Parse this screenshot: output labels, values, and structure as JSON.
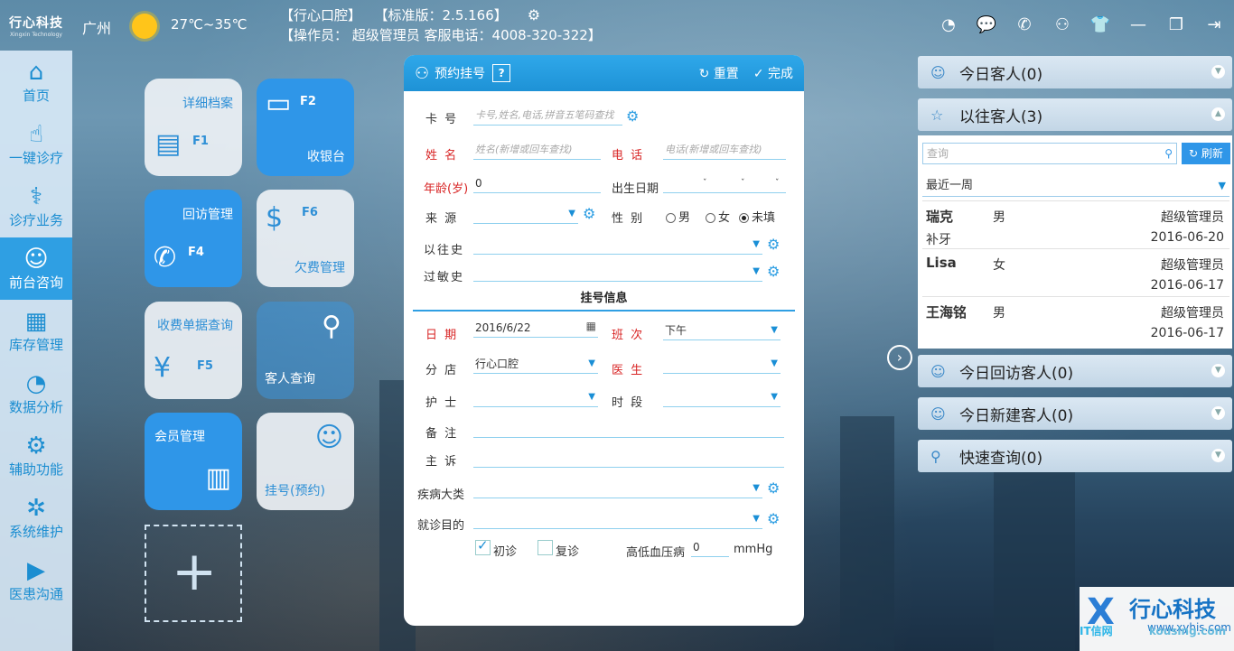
{
  "app": {
    "logo_text": "行心科技",
    "logo_sub": "Xingxin Technology"
  },
  "weather": {
    "city": "广州",
    "temp": "27℃~35℃"
  },
  "header": {
    "clinic": "【行心口腔】",
    "edition": "【标准版：2.5.166】",
    "operator": "【操作员： 超级管理员  客服电话：4008-320-322】"
  },
  "sidebar": {
    "items": [
      {
        "label": "首页",
        "icon": "home-icon"
      },
      {
        "label": "一键诊疗",
        "icon": "hand-icon"
      },
      {
        "label": "诊疗业务",
        "icon": "doctor-icon"
      },
      {
        "label": "前台咨询",
        "icon": "nurse-icon"
      },
      {
        "label": "库存管理",
        "icon": "store-icon"
      },
      {
        "label": "数据分析",
        "icon": "chart-icon"
      },
      {
        "label": "辅助功能",
        "icon": "gears-icon"
      },
      {
        "label": "系统维护",
        "icon": "wrench-icon"
      },
      {
        "label": "医患沟通",
        "icon": "video-icon"
      }
    ]
  },
  "tiles": {
    "detail": {
      "label": "详细档案",
      "key": "F1"
    },
    "cashier": {
      "label": "收银台",
      "key": "F2"
    },
    "followup": {
      "label": "回访管理",
      "key": "F4"
    },
    "arrears": {
      "label": "欠费管理",
      "key": "F6"
    },
    "receipt": {
      "label": "收费单据查询",
      "key": "F5"
    },
    "guest": {
      "label": "客人查询"
    },
    "member": {
      "label": "会员管理"
    },
    "register": {
      "label": "挂号(预约)"
    }
  },
  "form": {
    "title": "预约挂号",
    "help": "?",
    "reset": "重置",
    "done": "完成",
    "card_label": "卡 号",
    "card_ph": "卡号,姓名,电话,拼音五笔码查找",
    "name_label": "姓 名",
    "name_ph": "姓名(新增或回车查找)",
    "phone_label": "电 话",
    "phone_ph": "电话(新增或回车查找)",
    "age_label": "年龄(岁)",
    "age_value": "0",
    "birth_label": "出生日期",
    "source_label": "来 源",
    "gender_label": "性 别",
    "gender_male": "男",
    "gender_female": "女",
    "gender_unset": "未填",
    "history_label": "以往史",
    "allergy_label": "过敏史",
    "section": "挂号信息",
    "date_label": "日 期",
    "date_value": "2016/6/22",
    "shift_label": "班 次",
    "shift_value": "下午",
    "branch_label": "分 店",
    "branch_value": "行心口腔",
    "doctor_label": "医 生",
    "nurse_label": "护 士",
    "slot_label": "时 段",
    "remark_label": "备 注",
    "complaint_label": "主 诉",
    "disease_label": "疾病大类",
    "purpose_label": "就诊目的",
    "first_visit": "初诊",
    "revisit": "复诊",
    "bp_label": "高低血压病",
    "bp_value": "0",
    "bp_unit": "mmHg"
  },
  "right": {
    "today": "今日客人(0)",
    "past": "以往客人(3)",
    "search_ph": "查询",
    "refresh": "刷新",
    "range": "最近一周",
    "customers": [
      {
        "name": "瑞克",
        "sex": "男",
        "operator": "超级管理员",
        "note": "补牙",
        "date": "2016-06-20"
      },
      {
        "name": "Lisa",
        "sex": "女",
        "operator": "超级管理员",
        "note": "",
        "date": "2016-06-17"
      },
      {
        "name": "王海铭",
        "sex": "男",
        "operator": "超级管理员",
        "note": "",
        "date": "2016-06-17"
      }
    ],
    "followup": "今日回访客人(0)",
    "new": "今日新建客人(0)",
    "quick": "快速查询(0)"
  },
  "watermark": {
    "brand": "行心科技",
    "url": "www.xyhis.com",
    "site": "IT信网",
    "site_url": "kousing.com"
  }
}
